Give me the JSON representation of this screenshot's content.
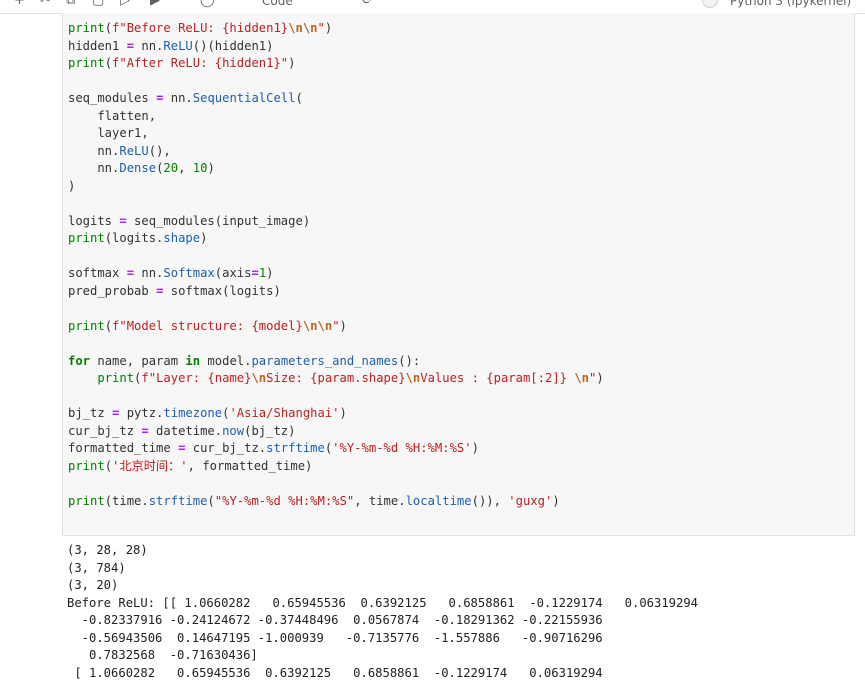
{
  "toolbar": {
    "buttons": [
      "+",
      "✂",
      "⧉",
      "▢",
      "▷",
      "▶",
      "◯",
      "⟳"
    ],
    "cell_type": "Code",
    "kernel": "Python 3 (ipykernel)"
  },
  "code_lines": [
    "print(f\"Before ReLU: {hidden1}\\n\\n\")",
    "hidden1 = nn.ReLU()(hidden1)",
    "print(f\"After ReLU: {hidden1}\")",
    "",
    "seq_modules = nn.SequentialCell(",
    "    flatten,",
    "    layer1,",
    "    nn.ReLU(),",
    "    nn.Dense(20, 10)",
    ")",
    "",
    "logits = seq_modules(input_image)",
    "print(logits.shape)",
    "",
    "softmax = nn.Softmax(axis=1)",
    "pred_probab = softmax(logits)",
    "",
    "print(f\"Model structure: {model}\\n\\n\")",
    "",
    "for name, param in model.parameters_and_names():",
    "    print(f\"Layer: {name}\\nSize: {param.shape}\\nValues : {param[:2]} \\n\")",
    "",
    "bj_tz = pytz.timezone('Asia/Shanghai')",
    "cur_bj_tz = datetime.now(bj_tz)",
    "formatted_time = cur_bj_tz.strftime('%Y-%m-%d %H:%M:%S')",
    "print('北京时间：', formatted_time)",
    "",
    "print(time.strftime(\"%Y-%m-%d %H:%M:%S\", time.localtime()), 'guxg')"
  ],
  "output_lines": [
    "(3, 28, 28)",
    "(3, 784)",
    "(3, 20)",
    "Before ReLU: [[ 1.0660282   0.65945536  0.6392125   0.6858861  -0.1229174   0.06319294",
    "  -0.82337916 -0.24124672 -0.37448496  0.0567874  -0.18291362 -0.22155936",
    "  -0.56943506  0.14647195 -1.000939   -0.7135776  -1.557886   -0.90716296",
    "   0.7832568  -0.71630436]",
    " [ 1.0660282   0.65945536  0.6392125   0.6858861  -0.1229174   0.06319294"
  ]
}
